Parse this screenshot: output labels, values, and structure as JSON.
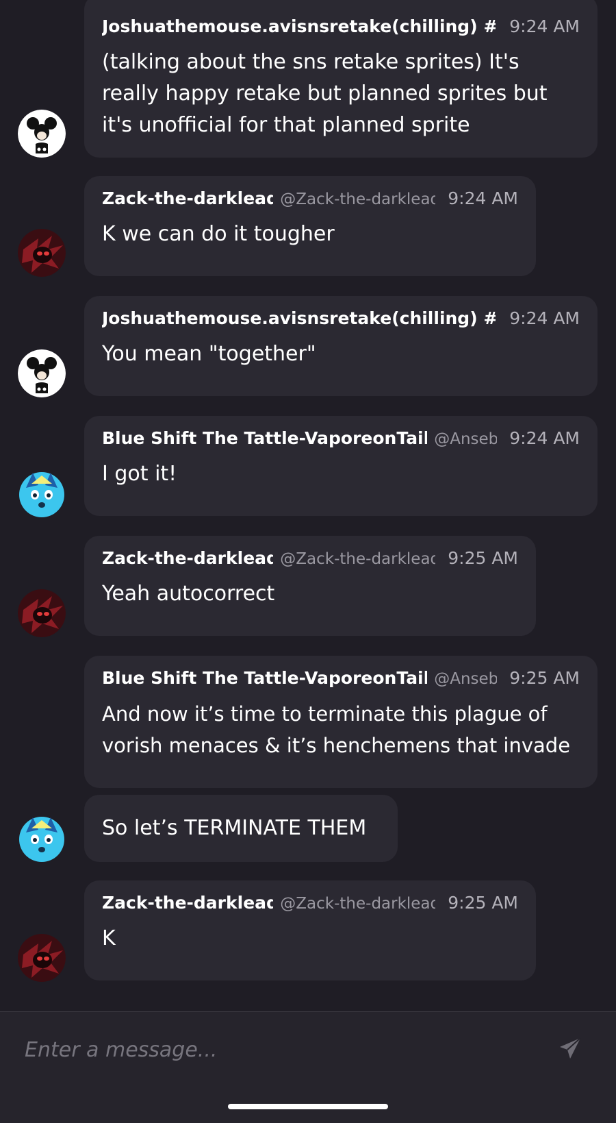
{
  "messages": [
    {
      "name": "Joshuathemouse.avisnsretake(chilling) #ac",
      "handle": "",
      "time": "9:24 AM",
      "text": "(talking about the sns retake sprites) It's really happy retake but planned sprites but it's unofficial for that planned sprite",
      "avatar": "mickey-mouse-avatar"
    },
    {
      "name": "Zack-the-darklead",
      "handle": "@Zack-the-darklead",
      "time": "9:24 AM",
      "text": "K we can do it tougher",
      "avatar": "dark-hedgehog-avatar"
    },
    {
      "name": "Joshuathemouse.avisnsretake(chilling) #ac",
      "handle": "",
      "time": "9:24 AM",
      "text": "You mean \"together\"",
      "avatar": "mickey-mouse-avatar"
    },
    {
      "name": "Blue Shift The Tattle-VaporeonTail",
      "handle": "@Anseb_",
      "time": "9:24 AM",
      "text": "I got it!",
      "avatar": "blue-creature-avatar"
    },
    {
      "name": "Zack-the-darklead",
      "handle": "@Zack-the-darklead",
      "time": "9:25 AM",
      "text": "Yeah autocorrect",
      "avatar": "dark-hedgehog-avatar"
    },
    {
      "name": "Blue Shift The Tattle-VaporeonTail",
      "handle": "@Anseb_",
      "time": "9:25 AM",
      "text": "And now it’s time to terminate this plague of vorish menaces & it’s henchemens that invade",
      "avatar": "blue-creature-avatar"
    },
    {
      "name": "",
      "handle": "",
      "time": "",
      "text": "So let’s TERMINATE THEM",
      "avatar": "blue-creature-avatar"
    },
    {
      "name": "Zack-the-darklead",
      "handle": "@Zack-the-darklead",
      "time": "9:25 AM",
      "text": "K",
      "avatar": "dark-hedgehog-avatar"
    }
  ],
  "composer": {
    "placeholder": "Enter a message...",
    "send_icon": "paper-plane-icon"
  },
  "colors": {
    "background": "#1f1d25",
    "bubble": "#2b2932",
    "muted": "#9a98a1"
  }
}
